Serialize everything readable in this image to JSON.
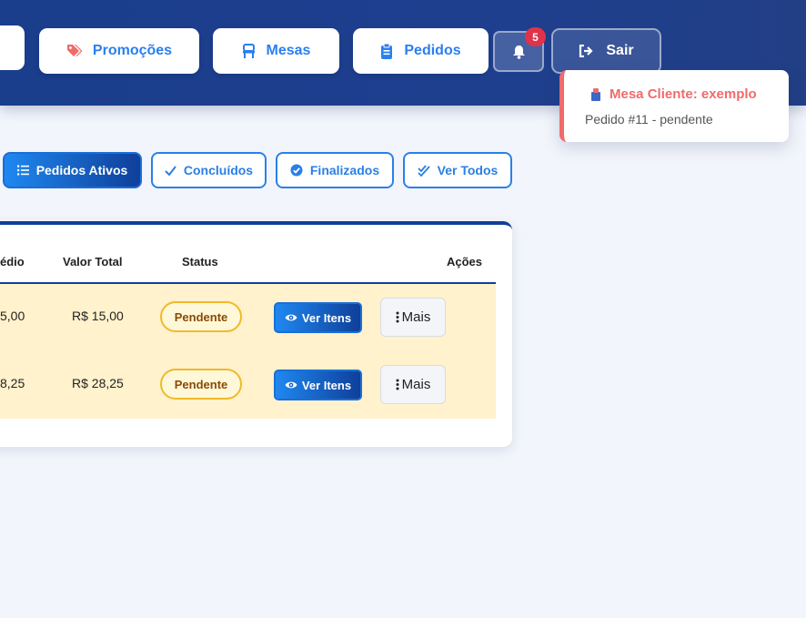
{
  "header": {
    "buttons": [
      {
        "label": "Promoções",
        "icon": "tags-icon",
        "icon_color": "#f06b6b"
      },
      {
        "label": "Mesas",
        "icon": "chair-icon",
        "icon_color": "#2a7ff0"
      },
      {
        "label": "Pedidos",
        "icon": "clipboard-icon",
        "icon_color": "#2a7ff0"
      }
    ],
    "notifications_count": "5",
    "logout_label": "Sair"
  },
  "notification": {
    "title": "Mesa Cliente: exemplo",
    "body": "Pedido #11 - pendente",
    "accent": "#f06b6b"
  },
  "tabs": [
    {
      "label": "Pedidos Ativos",
      "icon": "list-icon",
      "active": true
    },
    {
      "label": "Concluídos",
      "icon": "check-icon",
      "active": false
    },
    {
      "label": "Finalizados",
      "icon": "check-circle-icon",
      "active": false
    },
    {
      "label": "Ver Todos",
      "icon": "double-check-icon",
      "active": false
    }
  ],
  "table": {
    "columns": [
      "édio",
      "Valor Total",
      "Status",
      "Ações"
    ],
    "rows": [
      {
        "avg": "5,00",
        "total": "R$ 15,00",
        "status": "Pendente",
        "view_label": "Ver Itens",
        "more_label": "Mais"
      },
      {
        "avg": "8,25",
        "total": "R$ 28,25",
        "status": "Pendente",
        "view_label": "Ver Itens",
        "more_label": "Mais"
      }
    ]
  },
  "colors": {
    "header_bg": "#1a3d8c",
    "primary": "#2a7ff0",
    "row_bg": "#fff2cc",
    "pending_border": "#f0b92a"
  }
}
